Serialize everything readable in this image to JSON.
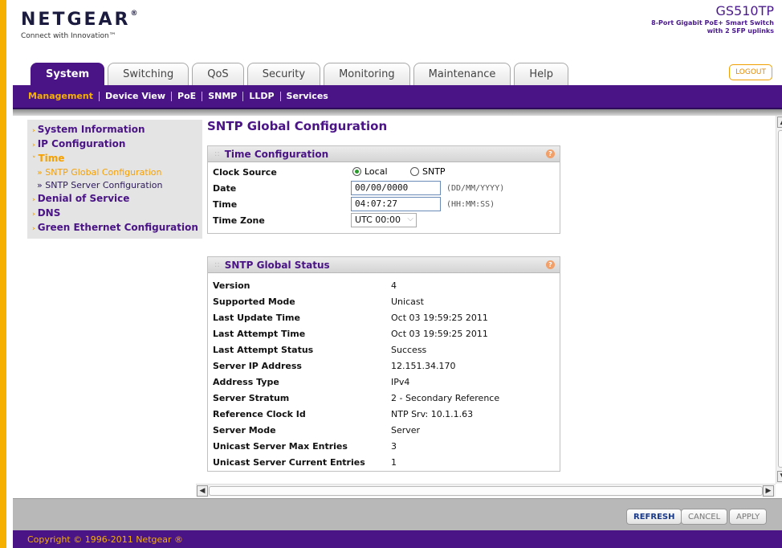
{
  "header": {
    "logo": "NETGEAR",
    "tagline": "Connect with Innovation™",
    "model": "GS510TP",
    "model_desc_line1": "8-Port Gigabit PoE+ Smart Switch",
    "model_desc_line2": "with 2 SFP uplinks",
    "logout_label": "LOGOUT"
  },
  "tabs": [
    {
      "label": "System",
      "active": true
    },
    {
      "label": "Switching"
    },
    {
      "label": "QoS"
    },
    {
      "label": "Security"
    },
    {
      "label": "Monitoring"
    },
    {
      "label": "Maintenance"
    },
    {
      "label": "Help"
    }
  ],
  "subnav": [
    "Management",
    "Device View",
    "PoE",
    "SNMP",
    "LLDP",
    "Services"
  ],
  "sidebar": {
    "items": [
      {
        "label": "System Information"
      },
      {
        "label": "IP Configuration"
      },
      {
        "label": "Time"
      },
      {
        "label": "» SNTP Global Configuration"
      },
      {
        "label": "» SNTP Server Configuration"
      },
      {
        "label": "Denial of Service"
      },
      {
        "label": "DNS"
      },
      {
        "label": "Green Ethernet Configuration"
      }
    ]
  },
  "page": {
    "title": "SNTP Global Configuration"
  },
  "time_config": {
    "title": "Time Configuration",
    "clock_source_label": "Clock Source",
    "radio_local": "Local",
    "radio_sntp": "SNTP",
    "date_label": "Date",
    "date_value": "00/00/0000",
    "date_hint": "(DD/MM/YYYY)",
    "time_label": "Time",
    "time_value": "04:07:27",
    "time_hint": "(HH:MM:SS)",
    "timezone_label": "Time Zone",
    "timezone_value": "UTC 00:00"
  },
  "sntp_status": {
    "title": "SNTP Global Status",
    "rows": [
      {
        "label": "Version",
        "value": "4"
      },
      {
        "label": "Supported Mode",
        "value": "Unicast"
      },
      {
        "label": "Last Update Time",
        "value": "Oct 03 19:59:25 2011"
      },
      {
        "label": "Last Attempt Time",
        "value": "Oct 03 19:59:25 2011"
      },
      {
        "label": "Last Attempt Status",
        "value": "Success"
      },
      {
        "label": "Server IP Address",
        "value": "12.151.34.170"
      },
      {
        "label": "Address Type",
        "value": "IPv4"
      },
      {
        "label": "Server Stratum",
        "value": "2 - Secondary Reference"
      },
      {
        "label": "Reference Clock Id",
        "value": "NTP Srv: 10.1.1.63"
      },
      {
        "label": "Server Mode",
        "value": "Server"
      },
      {
        "label": "Unicast Server Max Entries",
        "value": "3"
      },
      {
        "label": "Unicast Server Current Entries",
        "value": "1"
      }
    ]
  },
  "buttons": {
    "refresh": "REFRESH",
    "cancel": "CANCEL",
    "apply": "APPLY"
  },
  "footer": {
    "copyright": "Copyright © 1996-2011 Netgear ®"
  },
  "colors": {
    "brand_purple": "#4a1487",
    "brand_orange": "#f6b000"
  },
  "icons": [
    "help-icon",
    "radio-icon",
    "chevron-down-icon",
    "scroll-up-icon",
    "scroll-down-icon",
    "scroll-left-icon",
    "scroll-right-icon"
  ]
}
